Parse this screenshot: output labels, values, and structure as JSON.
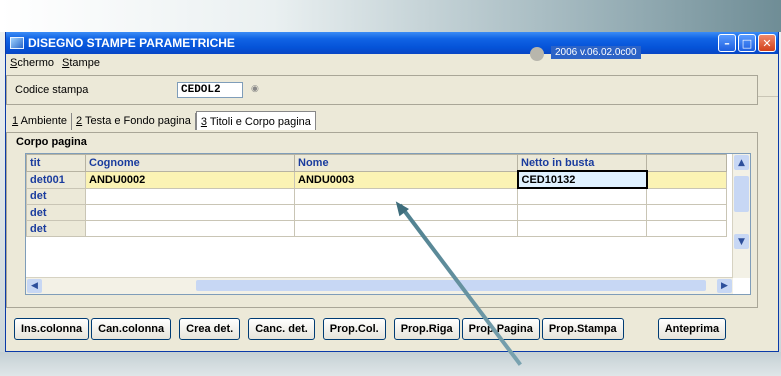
{
  "window": {
    "title": "DISEGNO STAMPE PARAMETRICHE"
  },
  "menu": [
    {
      "label": "Schermo"
    },
    {
      "label": "Stampe"
    }
  ],
  "toolbar": {
    "icons": [
      "save-icon",
      "back-icon",
      "open-icon",
      "first-icon",
      "prev-icon",
      "next-icon",
      "last-icon",
      "binoculars-icon",
      "search-icon",
      "run-icon",
      "stop-icon",
      "status-dot-icon"
    ],
    "version_label": "2006 v.06.02.0c00"
  },
  "codice": {
    "label": "Codice stampa",
    "value": "CEDOL2"
  },
  "tabs": [
    {
      "number": "1",
      "label": " Ambiente"
    },
    {
      "number": "2",
      "label": " Testa e Fondo pagina"
    },
    {
      "number": "3",
      "label": " Titoli e Corpo pagina"
    }
  ],
  "corpo": {
    "legend": "Corpo pagina",
    "columns": [
      "tit",
      "Cognome",
      "Nome",
      "Netto in busta",
      ""
    ],
    "rows": [
      [
        "det001",
        "ANDU0002",
        "ANDU0003",
        "CED10132",
        ""
      ],
      [
        "det",
        "",
        "",
        "",
        ""
      ],
      [
        "det",
        "",
        "",
        "",
        ""
      ],
      [
        "det",
        "",
        "",
        "",
        ""
      ]
    ]
  },
  "buttons": {
    "ins_colonna": "Ins.colonna",
    "can_colonna": "Can.colonna",
    "crea_det": "Crea det.",
    "canc_det": "Canc. det.",
    "prop_col": "Prop.Col.",
    "prop_riga": "Prop.Riga",
    "prop_pagina": "Prop.Pagina",
    "prop_stampa": "Prop.Stampa",
    "anteprima": "Anteprima"
  },
  "colors": {
    "title_bar": "#0553d8",
    "selected_row": "#fbf3b4",
    "header_text": "#1a3c9e"
  }
}
